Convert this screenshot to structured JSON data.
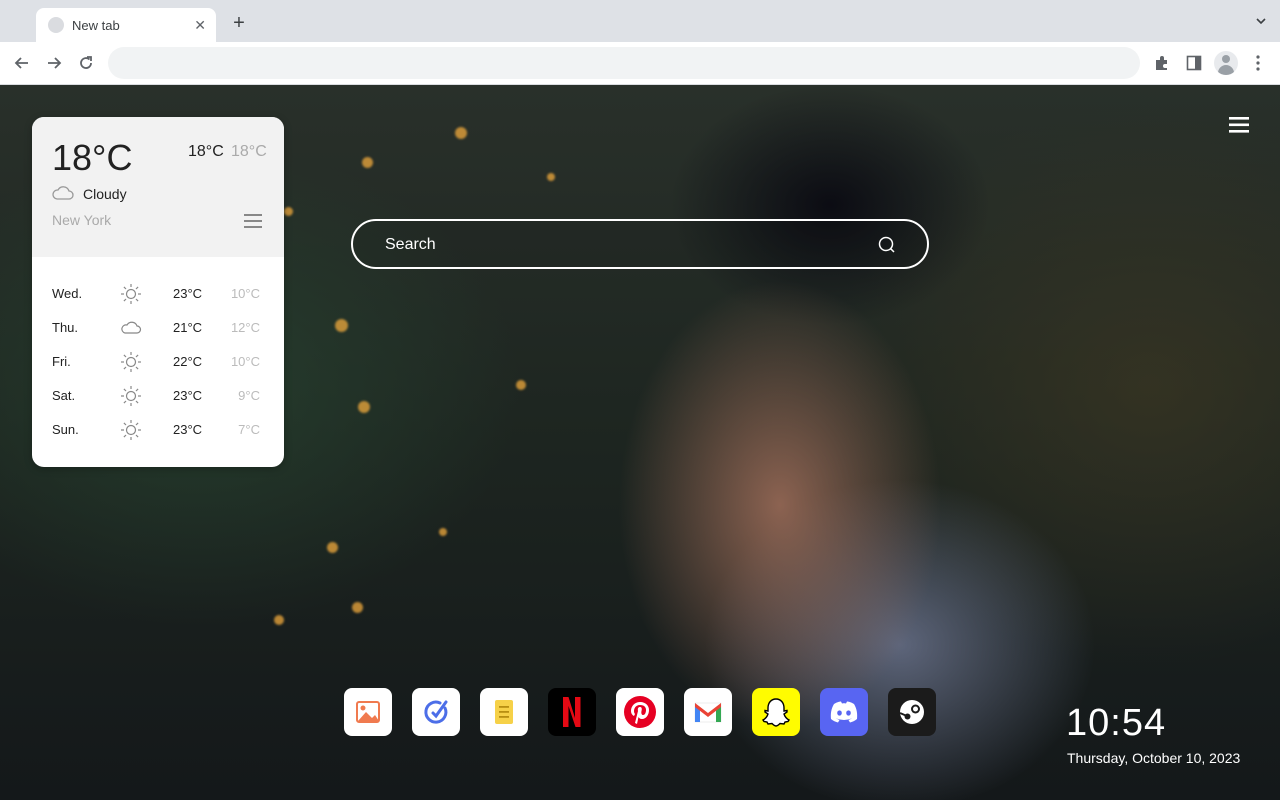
{
  "browser": {
    "tab_title": "New tab",
    "new_tab_label": "+",
    "close_label": "✕",
    "omnibox_value": ""
  },
  "weather": {
    "current_temp": "18°C",
    "high": "18°C",
    "low": "18°C",
    "condition": "Cloudy",
    "condition_icon": "cloud-icon",
    "city": "New York",
    "forecast": [
      {
        "day": "Wed.",
        "icon": "sun-icon",
        "high": "23°C",
        "low": "10°C"
      },
      {
        "day": "Thu.",
        "icon": "cloud-icon",
        "high": "21°C",
        "low": "12°C"
      },
      {
        "day": "Fri.",
        "icon": "sun-icon",
        "high": "22°C",
        "low": "10°C"
      },
      {
        "day": "Sat.",
        "icon": "sun-icon",
        "high": "23°C",
        "low": "9°C"
      },
      {
        "day": "Sun.",
        "icon": "sun-icon",
        "high": "23°C",
        "low": "7°C"
      }
    ]
  },
  "search": {
    "placeholder": "Search"
  },
  "apps": [
    {
      "name": "photos",
      "color": "#ffffff"
    },
    {
      "name": "tasks",
      "color": "#ffffff"
    },
    {
      "name": "notes",
      "color": "#ffffff"
    },
    {
      "name": "netflix",
      "color": "#000000"
    },
    {
      "name": "pinterest",
      "color": "#ffffff"
    },
    {
      "name": "gmail",
      "color": "#ffffff"
    },
    {
      "name": "snapchat",
      "color": "#fffc00"
    },
    {
      "name": "discord",
      "color": "#5865f2"
    },
    {
      "name": "steam",
      "color": "#1b1b1b"
    }
  ],
  "clock": {
    "time": "10:54",
    "date": "Thursday, October 10, 2023"
  }
}
